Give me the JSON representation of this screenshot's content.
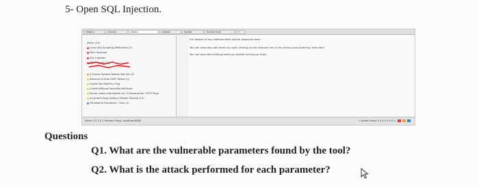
{
  "task": {
    "heading": "5- Open SQL Injection."
  },
  "tool_screenshot": {
    "toolbar_tabs": [
      "History",
      "Search",
      "Alerts",
      "Output",
      "Spider",
      "Active Scan",
      "+"
    ],
    "tree_items": [
      "Alerts (13)",
      "Cross Site Scripting (Reflected) (2)",
      "Path Traversal",
      "SQL Injection",
      "SQL Injection (2)",
      "X-Frame-Options Header Not Set (4)",
      "Absence of Anti-CSRF Tokens (2)",
      "Cookie No HttpOnly Flag",
      "Cookie Without SameSite Attribute",
      "Server Leaks Information via \"X-Powered-By\" HTTP Resp",
      "X-Content-Type-Options Header Missing (19)",
      "Timestamp Disclosure - Unix (2)"
    ],
    "detail_lines": [
      "Full details of any selected alert will be displayed here.",
      "You can manually add alerts by right clicking on the relevant line in the history and selecting 'Add alert'.",
      "You can also edit existing alerts by double clicking on them."
    ],
    "status_left": "Alerts  0  2  2  0  1   Primary Proxy: localhost:8080",
    "status_right": "Current Scans  0  0  0  0  0  0  0  0",
    "colors": {
      "high": "#e23b3b",
      "medium": "#f0a020",
      "low": "#e8d23a",
      "info": "#3b7fe0"
    }
  },
  "questions": {
    "heading": "Questions",
    "q1": "Q1. What are the vulnerable parameters found by the tool?",
    "q2": "Q2. What is the attack performed for each parameter?"
  }
}
